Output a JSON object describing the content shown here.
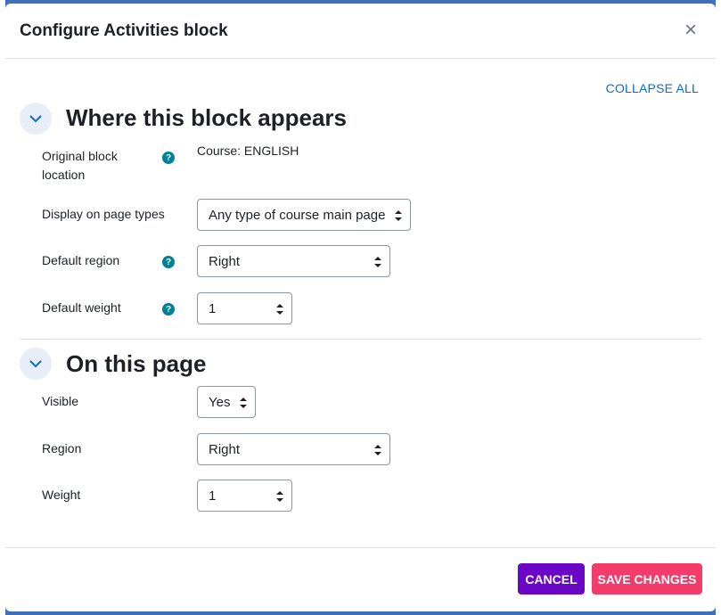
{
  "dialog": {
    "title": "Configure Activities block",
    "close_glyph": "×",
    "collapse_all_label": "COLLAPSE ALL"
  },
  "sections": [
    {
      "title": "Where this block appears",
      "rows": [
        {
          "label": "Original block location",
          "help": true,
          "value": "Course: ENGLISH"
        },
        {
          "label": "Display on page types",
          "help": false,
          "select": "Any type of course main page"
        },
        {
          "label": "Default region",
          "help": true,
          "select": "Right"
        },
        {
          "label": "Default weight",
          "help": true,
          "select": "1"
        }
      ]
    },
    {
      "title": "On this page",
      "rows": [
        {
          "label": "Visible",
          "select": "Yes"
        },
        {
          "label": "Region",
          "select": "Right"
        },
        {
          "label": "Weight",
          "select": "1"
        }
      ]
    }
  ],
  "help_glyph": "?",
  "footer": {
    "cancel_label": "CANCEL",
    "save_label": "SAVE CHANGES"
  },
  "colors": {
    "accent_link": "#0f6cbf",
    "help_icon": "#008196",
    "cancel_button": "#6a06c5",
    "save_button": "#f23d6b",
    "backdrop": "#3f6fb8"
  },
  "icons": [
    "close-icon",
    "chevron-down-icon",
    "question-icon",
    "select-arrows-icon"
  ]
}
